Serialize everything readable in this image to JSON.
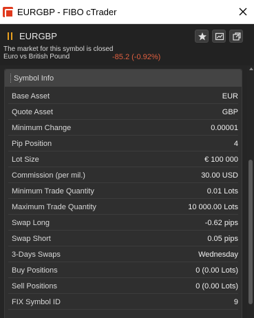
{
  "window": {
    "title": "EURGBP - FIBO cTrader"
  },
  "header": {
    "symbol": "EURGBP",
    "status": "The market for this symbol is closed",
    "description": "Euro vs British Pound",
    "change": "-85.2 (-0.92%)",
    "change_color": "#e06040",
    "accent_color": "#e8a020",
    "buttons": [
      "star-icon",
      "chart-icon",
      "popout-icon"
    ]
  },
  "panel": {
    "title": "Symbol Info",
    "rows": [
      {
        "label": "Base Asset",
        "value": "EUR"
      },
      {
        "label": "Quote Asset",
        "value": "GBP"
      },
      {
        "label": "Minimum Change",
        "value": "0.00001"
      },
      {
        "label": "Pip Position",
        "value": "4"
      },
      {
        "label": "Lot Size",
        "value": "€ 100 000"
      },
      {
        "label": "Commission (per mil.)",
        "value": "30.00 USD"
      },
      {
        "label": "Minimum Trade Quantity",
        "value": "0.01 Lots"
      },
      {
        "label": "Maximum Trade Quantity",
        "value": "10 000.00 Lots"
      },
      {
        "label": "Swap Long",
        "value": "-0.62 pips"
      },
      {
        "label": "Swap Short",
        "value": "0.05 pips"
      },
      {
        "label": "3-Days Swaps",
        "value": "Wednesday"
      },
      {
        "label": "Buy Positions",
        "value": "0 (0.00 Lots)"
      },
      {
        "label": "Sell Positions",
        "value": "0 (0.00 Lots)"
      },
      {
        "label": "FIX Symbol ID",
        "value": "9"
      }
    ]
  }
}
